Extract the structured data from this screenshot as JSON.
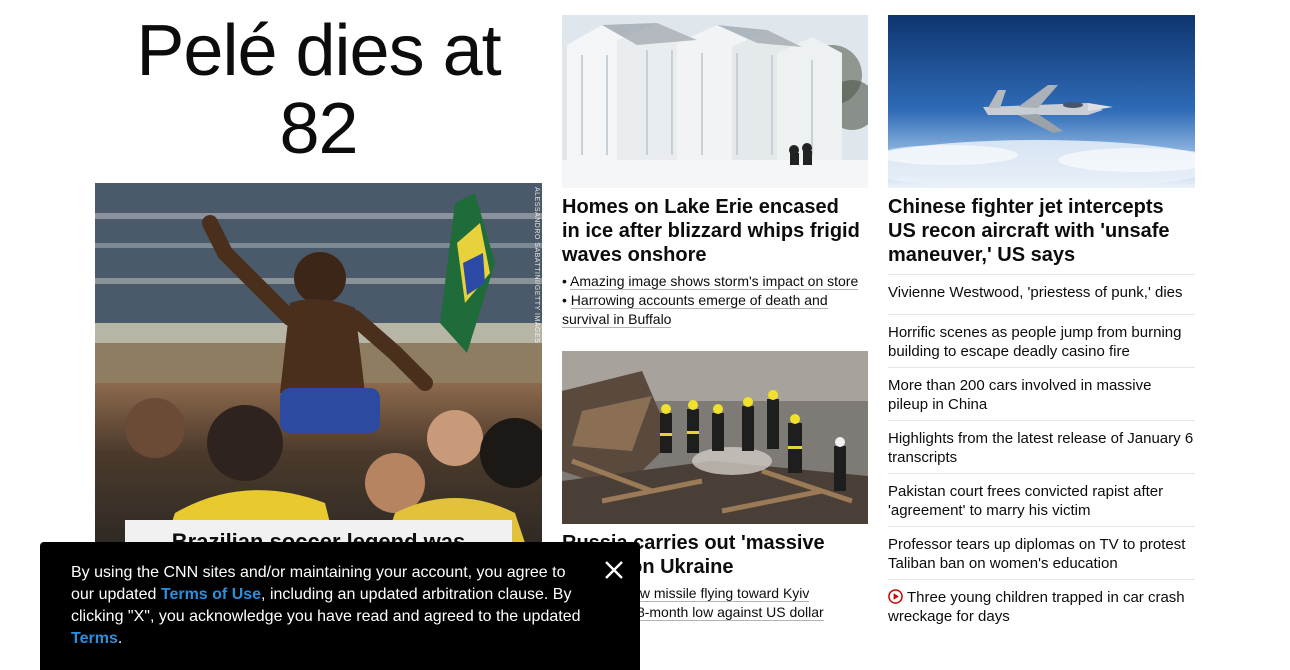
{
  "lead": {
    "headline": "Pelé dies at 82",
    "photo_credit": "ALESSANDRO SABATTINI/GETTY IMAGES",
    "caption": "Brazilian soccer legend was"
  },
  "stories": {
    "ice": {
      "headline": "Homes on Lake Erie encased in ice after blizzard whips frigid waves onshore",
      "bullets": [
        "Amazing image shows storm's impact on store",
        "Harrowing accounts emerge of death and survival in Buffalo"
      ]
    },
    "russia": {
      "headline": "Russia carries out 'massive attack' on Ukraine",
      "bullets": [
        "Videos show missile flying toward Kyiv",
        "Ruble hits 8-month low against US dollar"
      ]
    },
    "jet": {
      "headline": "Chinese fighter jet intercepts US recon aircraft with 'unsafe maneuver,' US says"
    }
  },
  "headline_list": [
    "Vivienne Westwood, 'priestess of punk,' dies",
    "Horrific scenes as people jump from burning building to escape deadly casino fire",
    "More than 200 cars involved in massive pileup in China",
    "Highlights from the latest release of January 6 transcripts",
    "Pakistan court frees convicted rapist after 'agreement' to marry his victim",
    "Professor tears up diplomas on TV to protest Taliban ban on women's education",
    "Three young children trapped in car crash wreckage for days"
  ],
  "terms_banner": {
    "text_1": "By using the CNN sites and/or maintaining your account, you agree to our updated ",
    "link_1": "Terms of Use",
    "text_2": ", including an updated arbitration clause. By clicking \"X\", you acknowledge you have read and agreed to the updated ",
    "link_2": "Terms",
    "text_3": "."
  },
  "colors": {
    "link_blue": "#2b8fe0",
    "video_red": "#cc0000",
    "banner_bg": "#000000"
  },
  "icons": {
    "close": "close-icon",
    "video": "play-icon"
  }
}
